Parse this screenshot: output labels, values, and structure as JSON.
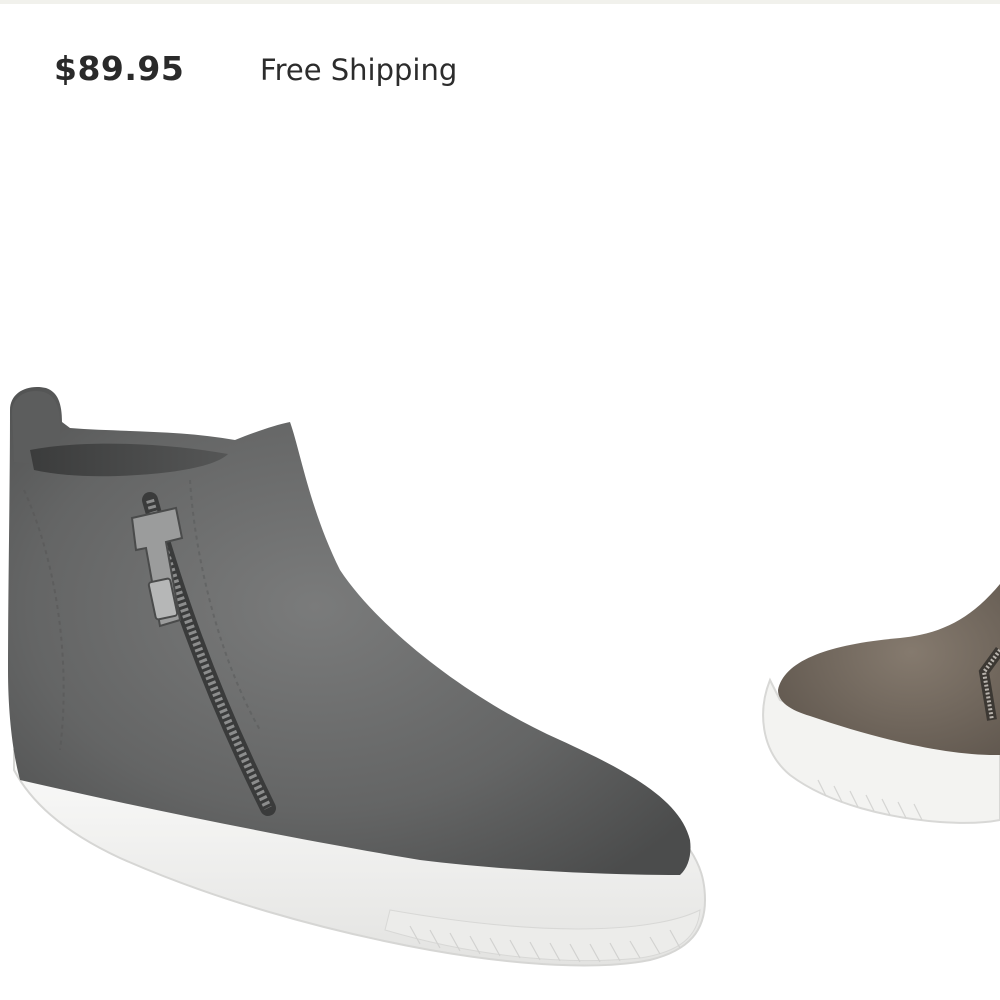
{
  "product": {
    "price": "$89.95",
    "shipping": "Free Shipping"
  },
  "carousel": {
    "items": [
      {
        "icon": "grey-suede-wedge-sneaker-image",
        "color": "#6d6e6e"
      },
      {
        "icon": "taupe-suede-wedge-sneaker-image",
        "color": "#7a6f63"
      }
    ]
  },
  "colors": {
    "text": "#2a2a2a",
    "sole": "#f4f4f2",
    "background": "#ffffff"
  }
}
